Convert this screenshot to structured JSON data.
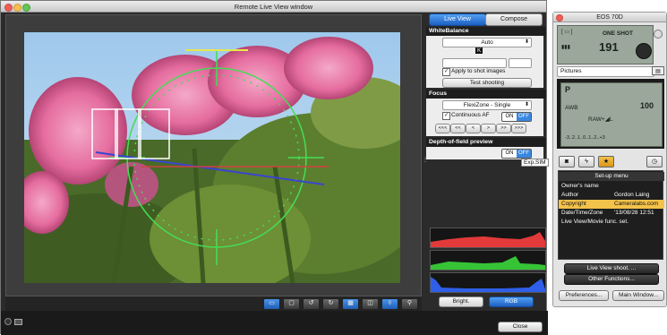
{
  "live_view_window": {
    "title": "Remote Live View window",
    "tabs": [
      {
        "label": "Live View",
        "active": true
      },
      {
        "label": "Compose",
        "active": false
      }
    ],
    "white_balance": {
      "heading": "WhiteBalance",
      "mode": "Auto",
      "k_label": "K",
      "apply_label": "Apply to shot images",
      "apply_checked": true,
      "test_button": "Test shooting"
    },
    "focus": {
      "heading": "Focus",
      "mode": "FlexiZone - Single",
      "continuous_label": "Continuous AF",
      "continuous_on": "ON",
      "continuous_off": "OFF",
      "continuous_state": "OFF",
      "af_buttons": [
        "<<<",
        "<<",
        "<",
        ">",
        ">>",
        ">>>"
      ]
    },
    "dof": {
      "heading": "Depth-of-field preview",
      "on": "ON",
      "off": "OFF",
      "state": "OFF"
    },
    "exp_sim_badge": "Exp.SIM",
    "histogram": {
      "bright_button": "Bright.",
      "rgb_button": "RGB",
      "active": "RGB",
      "channels": [
        {
          "name": "red",
          "color": "#e23a3a"
        },
        {
          "name": "green",
          "color": "#36c436"
        },
        {
          "name": "blue",
          "color": "#2f5fe8"
        }
      ]
    },
    "toolbar": {
      "buttons": [
        {
          "icon": "af-frame-icon",
          "glyph": "▭",
          "active": true
        },
        {
          "icon": "zoom-100-icon",
          "glyph": "▢",
          "active": false
        },
        {
          "icon": "rotate-left-icon",
          "glyph": "↺",
          "active": false
        },
        {
          "icon": "rotate-right-icon",
          "glyph": "↻",
          "active": false
        },
        {
          "icon": "grid-icon",
          "glyph": "▦",
          "active": true
        },
        {
          "icon": "aspect-ratio-icon",
          "glyph": "◫",
          "active": false
        },
        {
          "icon": "guide-lines-icon",
          "glyph": "◊",
          "active": true
        },
        {
          "icon": "magnify-icon",
          "glyph": "⚲",
          "active": false
        }
      ]
    },
    "close_button": "Close",
    "colors": {
      "accent": "#2f7fe4",
      "background": "#2b2b2b"
    }
  },
  "camera_window": {
    "title": "EOS 70D",
    "lcd": {
      "drive_mode": "ONE SHOT",
      "shots_remaining": "191",
      "top_mode": "P",
      "awb": "AWB",
      "image_quality": "RAW+◢L",
      "shots": "100",
      "exposure_scale": "-3..2..1..0..1..2..+3"
    },
    "pictures_label": "Pictures",
    "tabs_icons": [
      "camera-icon",
      "flash-icon",
      "custom-icon",
      "clock-icon"
    ],
    "menu": {
      "heading": "Set-up menu",
      "rows": [
        {
          "label": "Owner's name",
          "value": ""
        },
        {
          "label": "Author",
          "value": "Gordon Laing"
        },
        {
          "label": "Copyright",
          "value": "Cameralabs.com"
        },
        {
          "label": "Date/Time/Zone",
          "value": "'13/08/28 12:51"
        },
        {
          "label": "Live View/Movie func. set.",
          "value": ""
        }
      ],
      "selected_row": 2
    },
    "live_view_shoot_button": "Live View shoot. ...",
    "other_functions_button": "Other Functions...",
    "preferences_button": "Preferences...",
    "main_window_button": "Main Window..."
  }
}
